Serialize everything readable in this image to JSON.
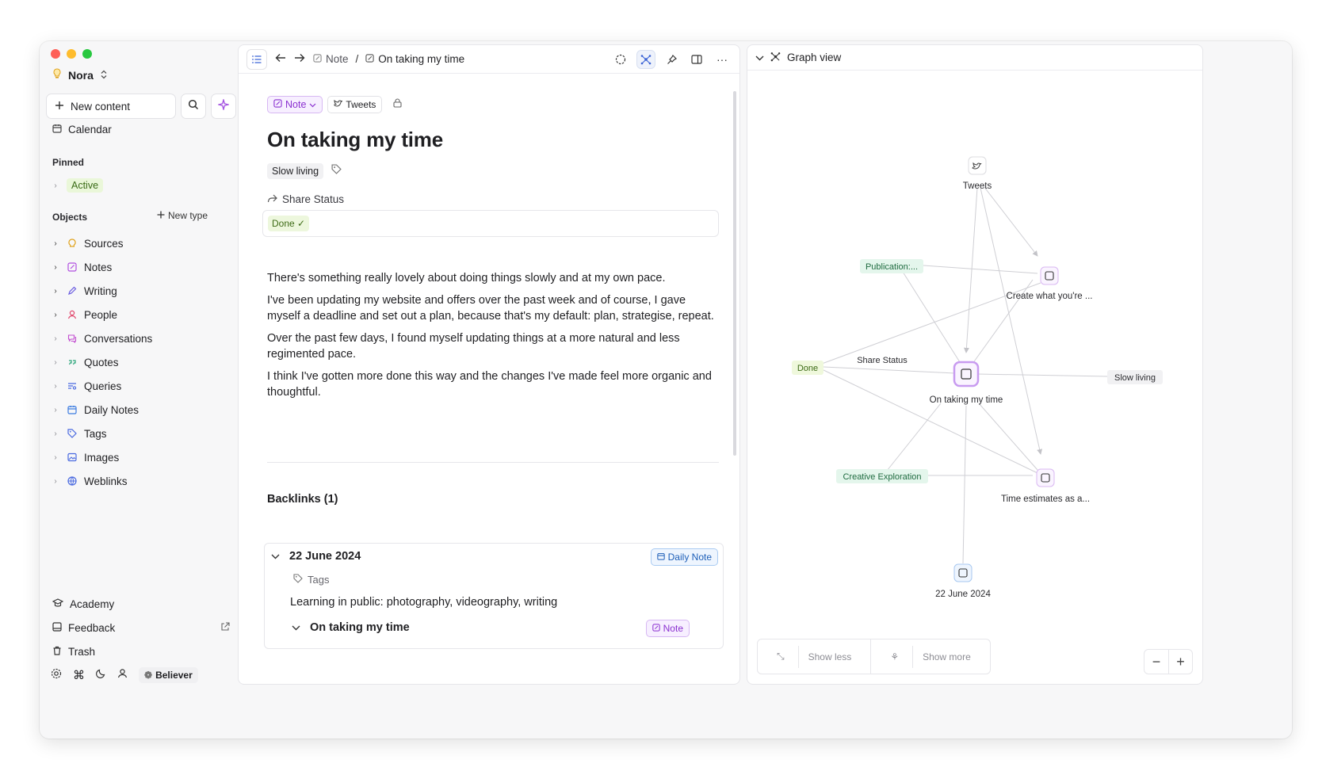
{
  "workspace": {
    "name": "Nora"
  },
  "sidebar": {
    "new_content_label": "New content",
    "calendar_label": "Calendar",
    "pinned_title": "Pinned",
    "pinned_items": [
      "Active"
    ],
    "objects_title": "Objects",
    "new_type_label": "New type",
    "objects": [
      {
        "label": "Sources",
        "icon": "bulb-icon",
        "color": "#e0a21b",
        "expandable": true
      },
      {
        "label": "Notes",
        "icon": "note-icon",
        "color": "#b14fe0",
        "expandable": true
      },
      {
        "label": "Writing",
        "icon": "pen-icon",
        "color": "#6a5ce0",
        "expandable": true
      },
      {
        "label": "People",
        "icon": "person-icon",
        "color": "#e0446a",
        "expandable": true
      },
      {
        "label": "Conversations",
        "icon": "chat-icon",
        "color": "#c34fd0",
        "expandable": false
      },
      {
        "label": "Quotes",
        "icon": "quote-icon",
        "color": "#2aa57a",
        "expandable": false
      },
      {
        "label": "Queries",
        "icon": "query-icon",
        "color": "#4a6ae0",
        "expandable": false
      },
      {
        "label": "Daily Notes",
        "icon": "calendar-icon",
        "color": "#3b7be0",
        "expandable": false
      },
      {
        "label": "Tags",
        "icon": "tag-icon",
        "color": "#4a6ae0",
        "expandable": false
      },
      {
        "label": "Images",
        "icon": "image-icon",
        "color": "#4a6ae0",
        "expandable": false
      },
      {
        "label": "Weblinks",
        "icon": "globe-icon",
        "color": "#4a6ae0",
        "expandable": false
      }
    ],
    "bottom": [
      "Academy",
      "Feedback",
      "Trash"
    ],
    "plan_label": "Believer"
  },
  "editor": {
    "breadcrumb": [
      "Note",
      "On taking my time"
    ],
    "type_chip": "Note",
    "collection_chip": "Tweets",
    "title": "On taking my time",
    "tag": "Slow living",
    "share_label": "Share Status",
    "share_value": "Done",
    "paragraphs": [
      "There's something really lovely about doing things slowly and at my own pace.",
      "I've been updating my website and offers over the past week and of course, I gave myself a deadline and set out a plan, because that's my default: plan, strategise, repeat.",
      "Over the past few days, I found myself updating things at a more natural and less regimented pace.",
      "I think I've gotten more done this way and the changes I've made feel more organic and thoughtful."
    ],
    "backlinks_title": "Backlinks (1)",
    "backlink": {
      "date": "22 June 2024",
      "badge": "Daily Note",
      "tags_label": "Tags",
      "line": "Learning in public: photography, videography, writing",
      "sub_title": "On taking my time",
      "sub_badge": "Note"
    }
  },
  "graph": {
    "title": "Graph view",
    "nodes": [
      {
        "id": "tweets",
        "label": "Tweets"
      },
      {
        "id": "publication",
        "label": "Publication:..."
      },
      {
        "id": "create",
        "label": "Create what you're ..."
      },
      {
        "id": "done",
        "label": "Done"
      },
      {
        "id": "share",
        "label": "Share Status"
      },
      {
        "id": "main",
        "label": "On taking my time"
      },
      {
        "id": "slow",
        "label": "Slow living"
      },
      {
        "id": "creative",
        "label": "Creative Exploration"
      },
      {
        "id": "time",
        "label": "Time estimates as a..."
      },
      {
        "id": "june",
        "label": "22 June 2024"
      }
    ],
    "show_less": "Show less",
    "show_more": "Show more"
  }
}
